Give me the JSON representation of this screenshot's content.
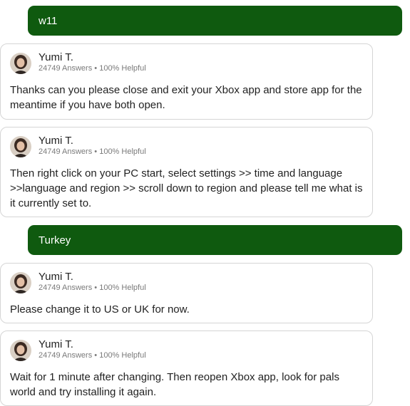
{
  "colors": {
    "user_bubble": "#0f5a0f",
    "user_text": "#ffffff",
    "card_border": "#d5d5d5"
  },
  "expert": {
    "name": "Yumi T.",
    "answers": "24749 Answers",
    "separator": "•",
    "helpful": "100% Helpful",
    "avatar_icon": "expert-avatar-photo"
  },
  "messages": [
    {
      "role": "user",
      "text": "w11"
    },
    {
      "role": "expert",
      "text": "Thanks can you please close and exit your Xbox app and store app for the meantime if you have both open."
    },
    {
      "role": "expert",
      "text": "Then right click on your PC start, select settings >> time and language >>language and region >> scroll down to region and please tell me what is it currently set to."
    },
    {
      "role": "user",
      "text": "Turkey"
    },
    {
      "role": "expert",
      "text": "Please change it to US or UK for now."
    },
    {
      "role": "expert",
      "text": "Wait for 1 minute after changing. Then reopen Xbox app, look for pals world and try installing it again."
    }
  ]
}
